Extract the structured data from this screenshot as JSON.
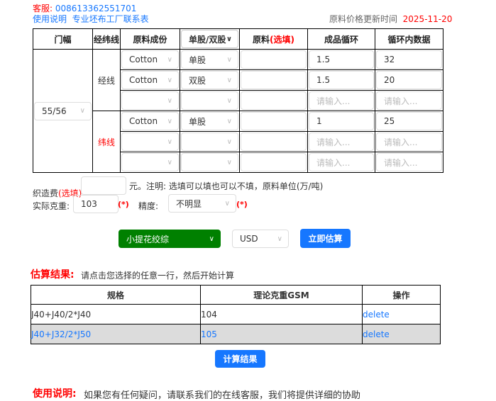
{
  "header": {
    "service_label": "客服:",
    "service_phone": "008613362551701",
    "link_usage": "使用说明",
    "link_factory": "专业坯布工厂联系表",
    "update_label": "原料价格更新时间",
    "update_date": "2025-11-20"
  },
  "table": {
    "headers": [
      "门幅",
      "经纬线",
      "原料成份",
      "单股/双股",
      "原料",
      "(选填)",
      "成品循环",
      "循环内数据"
    ],
    "width": "55/56",
    "warp_label": "经线",
    "weft_label": "纬线",
    "placeholder": "请输入...",
    "warp_rows": [
      {
        "material": "Cotton",
        "ply": "单股",
        "raw": "",
        "cycle": "1.5",
        "data": "32"
      },
      {
        "material": "Cotton",
        "ply": "双股",
        "raw": "",
        "cycle": "1.5",
        "data": "20"
      },
      {
        "material": "",
        "ply": "",
        "raw": "",
        "cycle": "",
        "data": ""
      }
    ],
    "weft_rows": [
      {
        "material": "Cotton",
        "ply": "单股",
        "raw": "",
        "cycle": "1",
        "data": "25"
      },
      {
        "material": "",
        "ply": "",
        "raw": "",
        "cycle": "",
        "data": ""
      },
      {
        "material": "",
        "ply": "",
        "raw": "",
        "cycle": "",
        "data": ""
      }
    ]
  },
  "form": {
    "fee_label": "织造费",
    "fee_optional": "(选填)",
    "fee_value": "",
    "fee_note": "元。注明: 选填可以填也可以不填，原料单位(万/吨)",
    "weight_label": "实际克重:",
    "weight_value": "103",
    "required": "(*)",
    "precision_label": "精度:",
    "precision_value": "不明显"
  },
  "actions": {
    "type_value": "小提花绞综",
    "currency_value": "USD",
    "estimate_button": "立即估算"
  },
  "results": {
    "title": "估算结果:",
    "hint": "请点击您选择的任意一行，然后开始计算",
    "headers": [
      "规格",
      "理论克重GSM",
      "操作"
    ],
    "rows": [
      {
        "spec": "J40+J40/2*J40",
        "gsm": "104",
        "action": "delete"
      },
      {
        "spec": "J40+J32/2*J50",
        "gsm": "105",
        "action": "delete"
      }
    ],
    "calc_button": "计算结果"
  },
  "footer": {
    "title": "使用说明:",
    "text": "如果您有任何疑问，请联系我们的在线客服，我们将提供详细的协助"
  },
  "colors": {
    "accent": "#1677ff",
    "green": "#008000",
    "red": "#ff0000"
  }
}
